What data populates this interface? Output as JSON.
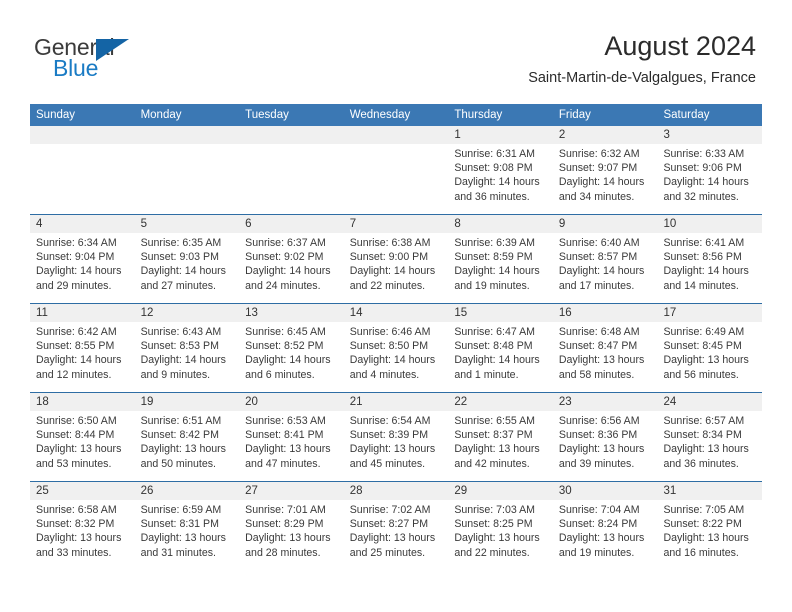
{
  "brand": {
    "name_top": "General",
    "name_bottom": "Blue",
    "triangle_icon": "triangle-logo-icon",
    "color_blue": "#1a7bc4",
    "color_dark": "#3b3b3b"
  },
  "header": {
    "title": "August 2024",
    "subtitle": "Saint-Martin-de-Valgalgues, France"
  },
  "theme": {
    "header_bar": "#3b78b4",
    "row_divider": "#2e6da4",
    "date_band": "#f0f0f0",
    "text": "#3a3a3a"
  },
  "weekdays": [
    "Sunday",
    "Monday",
    "Tuesday",
    "Wednesday",
    "Thursday",
    "Friday",
    "Saturday"
  ],
  "weeks": [
    [
      {
        "day": "",
        "lines": []
      },
      {
        "day": "",
        "lines": []
      },
      {
        "day": "",
        "lines": []
      },
      {
        "day": "",
        "lines": []
      },
      {
        "day": "1",
        "lines": [
          "Sunrise: 6:31 AM",
          "Sunset: 9:08 PM",
          "Daylight: 14 hours",
          "and 36 minutes."
        ]
      },
      {
        "day": "2",
        "lines": [
          "Sunrise: 6:32 AM",
          "Sunset: 9:07 PM",
          "Daylight: 14 hours",
          "and 34 minutes."
        ]
      },
      {
        "day": "3",
        "lines": [
          "Sunrise: 6:33 AM",
          "Sunset: 9:06 PM",
          "Daylight: 14 hours",
          "and 32 minutes."
        ]
      }
    ],
    [
      {
        "day": "4",
        "lines": [
          "Sunrise: 6:34 AM",
          "Sunset: 9:04 PM",
          "Daylight: 14 hours",
          "and 29 minutes."
        ]
      },
      {
        "day": "5",
        "lines": [
          "Sunrise: 6:35 AM",
          "Sunset: 9:03 PM",
          "Daylight: 14 hours",
          "and 27 minutes."
        ]
      },
      {
        "day": "6",
        "lines": [
          "Sunrise: 6:37 AM",
          "Sunset: 9:02 PM",
          "Daylight: 14 hours",
          "and 24 minutes."
        ]
      },
      {
        "day": "7",
        "lines": [
          "Sunrise: 6:38 AM",
          "Sunset: 9:00 PM",
          "Daylight: 14 hours",
          "and 22 minutes."
        ]
      },
      {
        "day": "8",
        "lines": [
          "Sunrise: 6:39 AM",
          "Sunset: 8:59 PM",
          "Daylight: 14 hours",
          "and 19 minutes."
        ]
      },
      {
        "day": "9",
        "lines": [
          "Sunrise: 6:40 AM",
          "Sunset: 8:57 PM",
          "Daylight: 14 hours",
          "and 17 minutes."
        ]
      },
      {
        "day": "10",
        "lines": [
          "Sunrise: 6:41 AM",
          "Sunset: 8:56 PM",
          "Daylight: 14 hours",
          "and 14 minutes."
        ]
      }
    ],
    [
      {
        "day": "11",
        "lines": [
          "Sunrise: 6:42 AM",
          "Sunset: 8:55 PM",
          "Daylight: 14 hours",
          "and 12 minutes."
        ]
      },
      {
        "day": "12",
        "lines": [
          "Sunrise: 6:43 AM",
          "Sunset: 8:53 PM",
          "Daylight: 14 hours",
          "and 9 minutes."
        ]
      },
      {
        "day": "13",
        "lines": [
          "Sunrise: 6:45 AM",
          "Sunset: 8:52 PM",
          "Daylight: 14 hours",
          "and 6 minutes."
        ]
      },
      {
        "day": "14",
        "lines": [
          "Sunrise: 6:46 AM",
          "Sunset: 8:50 PM",
          "Daylight: 14 hours",
          "and 4 minutes."
        ]
      },
      {
        "day": "15",
        "lines": [
          "Sunrise: 6:47 AM",
          "Sunset: 8:48 PM",
          "Daylight: 14 hours",
          "and 1 minute."
        ]
      },
      {
        "day": "16",
        "lines": [
          "Sunrise: 6:48 AM",
          "Sunset: 8:47 PM",
          "Daylight: 13 hours",
          "and 58 minutes."
        ]
      },
      {
        "day": "17",
        "lines": [
          "Sunrise: 6:49 AM",
          "Sunset: 8:45 PM",
          "Daylight: 13 hours",
          "and 56 minutes."
        ]
      }
    ],
    [
      {
        "day": "18",
        "lines": [
          "Sunrise: 6:50 AM",
          "Sunset: 8:44 PM",
          "Daylight: 13 hours",
          "and 53 minutes."
        ]
      },
      {
        "day": "19",
        "lines": [
          "Sunrise: 6:51 AM",
          "Sunset: 8:42 PM",
          "Daylight: 13 hours",
          "and 50 minutes."
        ]
      },
      {
        "day": "20",
        "lines": [
          "Sunrise: 6:53 AM",
          "Sunset: 8:41 PM",
          "Daylight: 13 hours",
          "and 47 minutes."
        ]
      },
      {
        "day": "21",
        "lines": [
          "Sunrise: 6:54 AM",
          "Sunset: 8:39 PM",
          "Daylight: 13 hours",
          "and 45 minutes."
        ]
      },
      {
        "day": "22",
        "lines": [
          "Sunrise: 6:55 AM",
          "Sunset: 8:37 PM",
          "Daylight: 13 hours",
          "and 42 minutes."
        ]
      },
      {
        "day": "23",
        "lines": [
          "Sunrise: 6:56 AM",
          "Sunset: 8:36 PM",
          "Daylight: 13 hours",
          "and 39 minutes."
        ]
      },
      {
        "day": "24",
        "lines": [
          "Sunrise: 6:57 AM",
          "Sunset: 8:34 PM",
          "Daylight: 13 hours",
          "and 36 minutes."
        ]
      }
    ],
    [
      {
        "day": "25",
        "lines": [
          "Sunrise: 6:58 AM",
          "Sunset: 8:32 PM",
          "Daylight: 13 hours",
          "and 33 minutes."
        ]
      },
      {
        "day": "26",
        "lines": [
          "Sunrise: 6:59 AM",
          "Sunset: 8:31 PM",
          "Daylight: 13 hours",
          "and 31 minutes."
        ]
      },
      {
        "day": "27",
        "lines": [
          "Sunrise: 7:01 AM",
          "Sunset: 8:29 PM",
          "Daylight: 13 hours",
          "and 28 minutes."
        ]
      },
      {
        "day": "28",
        "lines": [
          "Sunrise: 7:02 AM",
          "Sunset: 8:27 PM",
          "Daylight: 13 hours",
          "and 25 minutes."
        ]
      },
      {
        "day": "29",
        "lines": [
          "Sunrise: 7:03 AM",
          "Sunset: 8:25 PM",
          "Daylight: 13 hours",
          "and 22 minutes."
        ]
      },
      {
        "day": "30",
        "lines": [
          "Sunrise: 7:04 AM",
          "Sunset: 8:24 PM",
          "Daylight: 13 hours",
          "and 19 minutes."
        ]
      },
      {
        "day": "31",
        "lines": [
          "Sunrise: 7:05 AM",
          "Sunset: 8:22 PM",
          "Daylight: 13 hours",
          "and 16 minutes."
        ]
      }
    ]
  ]
}
